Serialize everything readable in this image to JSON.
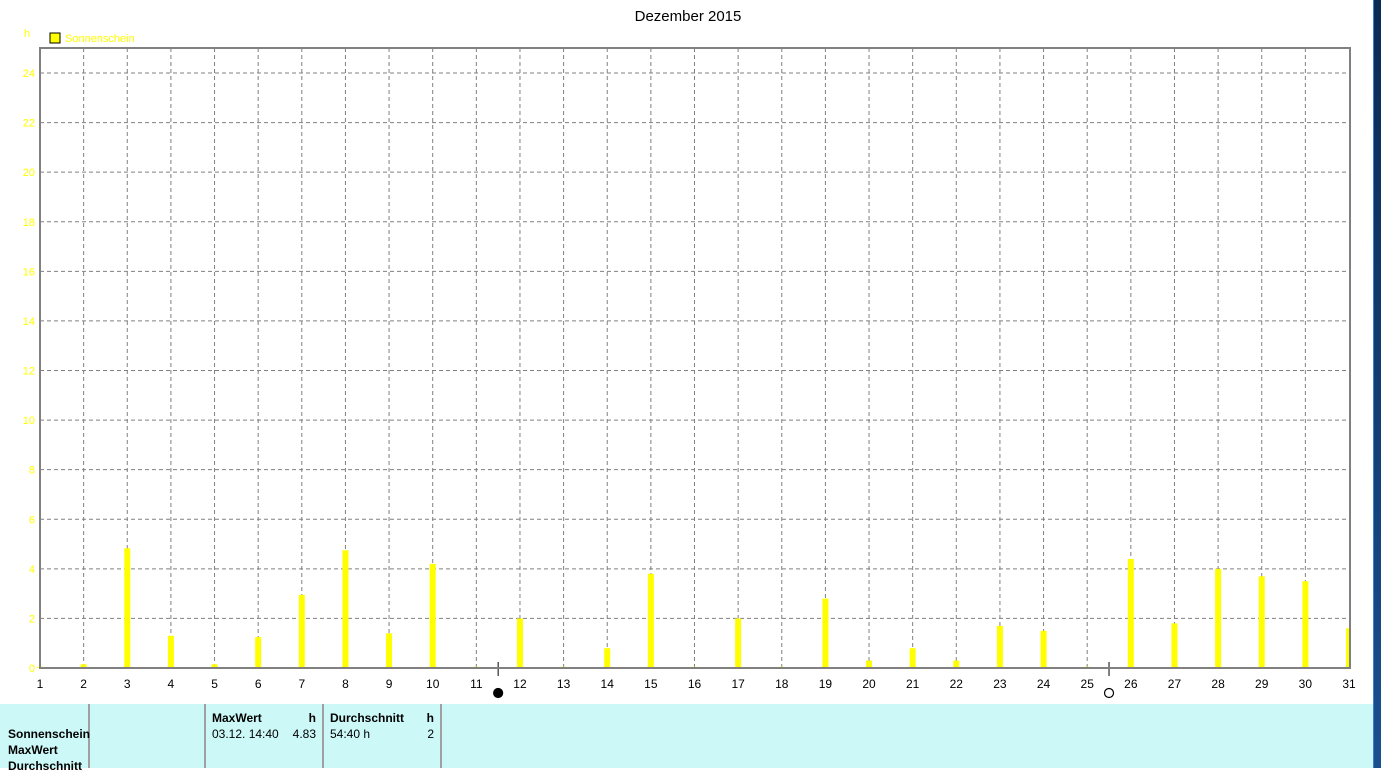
{
  "chart_data": {
    "type": "bar",
    "title": "Dezember 2015",
    "ylabel": "h",
    "legend": {
      "entries": [
        "Sonnenschein"
      ],
      "placement": "top-left"
    },
    "series": [
      {
        "name": "Sonnenschein",
        "color": "#ffff00",
        "values": [
          0.05,
          0.15,
          4.83,
          1.3,
          0.15,
          1.25,
          2.95,
          4.75,
          1.4,
          4.2,
          0.05,
          2.0,
          0.05,
          0.8,
          3.8,
          0.05,
          2.0,
          0.05,
          2.8,
          0.3,
          0.8,
          0.3,
          1.7,
          1.5,
          0.05,
          4.4,
          1.8,
          4.0,
          3.7,
          3.5,
          1.6
        ]
      }
    ],
    "categories": [
      "1",
      "2",
      "3",
      "4",
      "5",
      "6",
      "7",
      "8",
      "9",
      "10",
      "11",
      "12",
      "13",
      "14",
      "15",
      "16",
      "17",
      "18",
      "19",
      "20",
      "21",
      "22",
      "23",
      "24",
      "25",
      "26",
      "27",
      "28",
      "29",
      "30",
      "31"
    ],
    "yticks": [
      "0",
      "2",
      "4",
      "6",
      "8",
      "10",
      "12",
      "14",
      "16",
      "18",
      "20",
      "22",
      "24"
    ],
    "ylim": [
      0,
      24
    ],
    "grid": true,
    "moon_phases": [
      {
        "day": 11.5,
        "phase": "new-moon"
      },
      {
        "day": 25.5,
        "phase": "full-moon"
      }
    ]
  },
  "stats": {
    "row_labels": [
      "Sonnenschein",
      "MaxWert",
      "Durchschnitt"
    ],
    "max_header": "MaxWert",
    "max_unit": "h",
    "max_date": "03.12.  14:40",
    "max_value": "4.83",
    "avg_header": "Durchschnitt",
    "avg_unit": "h",
    "avg_total": "54:40 h",
    "avg_value": "2"
  }
}
